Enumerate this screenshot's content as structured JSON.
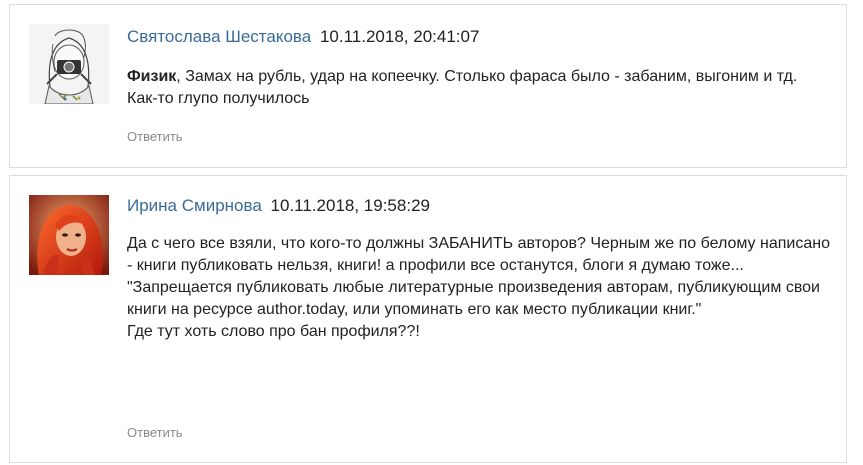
{
  "comments": [
    {
      "author": "Святослава Шестакова",
      "date": "10.11.2018, 20:41:07",
      "mention": "Физик",
      "text": ", Замах на рубль, удар на копеечку. Столько фараса было - забаним, выгоним и тд. Как-то глупо получилось",
      "reply_label": "Ответить",
      "avatar_icon": "sketch-girl-camera-avatar"
    },
    {
      "author": "Ирина Смирнова",
      "date": "10.11.2018, 19:58:29",
      "lines": [
        "Да с чего все взяли, что кого-то должны ЗАБАНИТЬ авторов? Черным же по белому написано - книги публиковать нельзя, книги! а профили все останутся, блоги я думаю тоже...",
        "\"Запрещается публиковать любые литературные произведения авторам, публикующим свои книги на ресурсе author.today, или упоминать его как место публикации книг.\"",
        "Где тут хоть слово про бан профиля??!"
      ],
      "reply_label": "Ответить",
      "avatar_icon": "red-haired-woman-avatar"
    }
  ]
}
